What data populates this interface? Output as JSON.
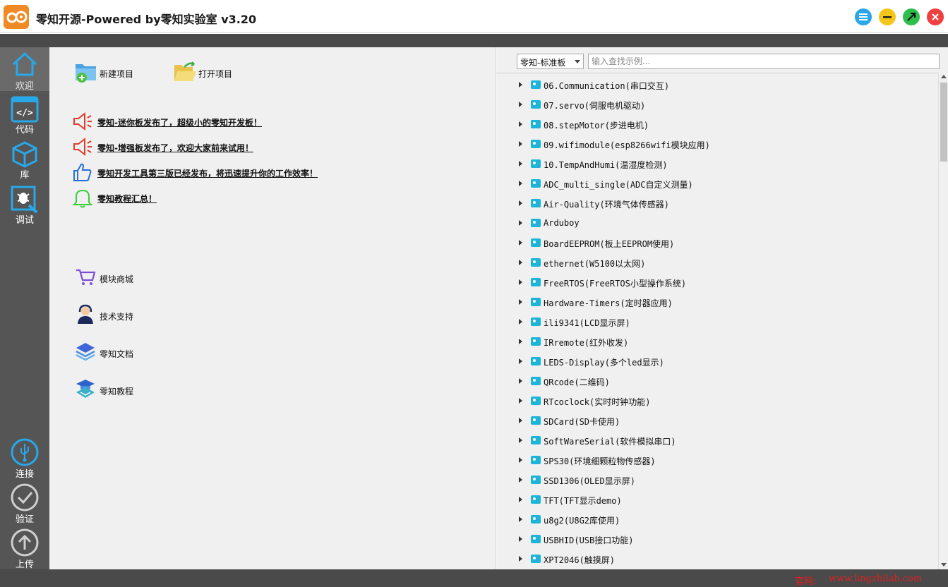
{
  "window": {
    "title": "零知开源-Powered by零知实验室 v3.20"
  },
  "sidebar": {
    "items": [
      {
        "label": "欢迎",
        "icon": "home-icon"
      },
      {
        "label": "代码",
        "icon": "code-icon"
      },
      {
        "label": "库",
        "icon": "cube-icon"
      },
      {
        "label": "调试",
        "icon": "debug-icon"
      }
    ],
    "bottom_items": [
      {
        "label": "连接",
        "icon": "usb-icon"
      },
      {
        "label": "验证",
        "icon": "check-icon"
      },
      {
        "label": "上传",
        "icon": "upload-icon"
      }
    ]
  },
  "welcome": {
    "new_project": "新建项目",
    "open_project": "打开项目",
    "news": [
      {
        "text": "零知-迷你板发布了，超级小的零知开发板！",
        "icon": "megaphone-icon"
      },
      {
        "text": "零知-增强板发布了，欢迎大家前来试用！",
        "icon": "megaphone-icon"
      },
      {
        "text": "零知开发工具第三版已经发布，将迅速提升你的工作效率！",
        "icon": "thumbs-up-icon"
      },
      {
        "text": "零知教程汇总！",
        "icon": "bell-icon"
      }
    ],
    "resources": [
      {
        "text": "模块商城",
        "icon": "cart-icon"
      },
      {
        "text": "技术支持",
        "icon": "support-icon"
      },
      {
        "text": "零知文档",
        "icon": "layers-icon"
      },
      {
        "text": "零知教程",
        "icon": "graduation-icon"
      }
    ]
  },
  "examples": {
    "board": "零知-标准板",
    "search_placeholder": "输入查找示例...",
    "items": [
      "06.Communication(串口交互)",
      "07.servo(伺服电机驱动)",
      "08.stepMotor(步进电机)",
      "09.wifimodule(esp8266wifi模块应用)",
      "10.TempAndHumi(温湿度检测)",
      "ADC_multi_single(ADC自定义测量)",
      "Air-Quality(环境气体传感器)",
      "Arduboy",
      "BoardEEPROM(板上EEPROM使用)",
      "ethernet(W5100以太网)",
      "FreeRTOS(FreeRTOS小型操作系统)",
      "Hardware-Timers(定时器应用)",
      "ili9341(LCD显示屏)",
      "IRremote(红外收发)",
      "LEDS-Display(多个led显示)",
      "QRcode(二维码)",
      "RTcoclock(实时时钟功能)",
      "SDCard(SD卡使用)",
      "SoftWareSerial(软件模拟串口)",
      "SPS30(环境细颗粒物传感器)",
      "SSD1306(OLED显示屏)",
      "TFT(TFT显示demo)",
      "u8g2(U8G2库使用)",
      "USBHID(USB接口功能)",
      "XPT2046(触摸屏)"
    ]
  },
  "statusbar": {
    "site_label": "官网:",
    "site_url": "www.lingzhilab.com"
  },
  "colors": {
    "accent_blue": "#2aa7e9",
    "sidebar_bg": "#555555",
    "link_red": "#e02020"
  }
}
